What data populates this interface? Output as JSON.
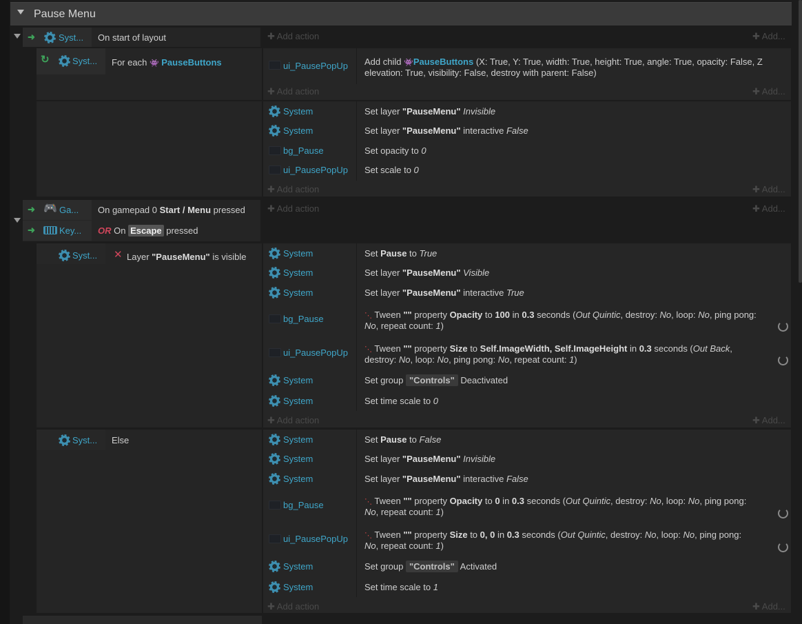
{
  "group": {
    "title": "Pause Menu"
  },
  "add_action": "Add action",
  "add_short": "Add...",
  "ev1": {
    "cond_obj": "Syst...",
    "cond_text": "On start of layout"
  },
  "ev1a": {
    "cond_obj": "Syst...",
    "cond_pre": "For each",
    "cond_target": "PauseButtons",
    "act_obj": "ui_PausePopUp",
    "act_pre": "Add child",
    "act_target": "PauseButtons",
    "act_line1": "(X: True, Y: True, width: True, height: True, angle: True, opacity: False, Z",
    "act_line2": "elevation: True, visibility: False, destroy with parent: False)"
  },
  "ev1b": {
    "actions": [
      {
        "obj": "System",
        "p1": "Set layer ",
        "b": "\"PauseMenu\"",
        "p2": " ",
        "it": "Invisible"
      },
      {
        "obj": "System",
        "p1": "Set layer ",
        "b": "\"PauseMenu\"",
        "p2": " interactive ",
        "it": "False"
      },
      {
        "obj": "bg_Pause",
        "p1": "Set opacity to ",
        "b": "",
        "p2": "",
        "it": "0"
      },
      {
        "obj": "ui_PausePopUp",
        "p1": "Set scale to ",
        "b": "",
        "p2": "",
        "it": "0"
      }
    ]
  },
  "ev2": {
    "c1_obj": "Ga...",
    "c1_pre": "On gamepad 0 ",
    "c1_bold": "Start / Menu",
    "c1_post": " pressed",
    "c2_obj": "Key...",
    "c2_or": "OR",
    "c2_pre": " On ",
    "c2_key": "Escape",
    "c2_post": " pressed"
  },
  "ev2a": {
    "cond_obj": "Syst...",
    "cond_pre": "Layer ",
    "cond_bold": "\"PauseMenu\"",
    "cond_post": " is visible",
    "a1": {
      "obj": "System",
      "p1": "Set ",
      "b": "Pause",
      "p2": " to ",
      "it": "True"
    },
    "a2": {
      "obj": "System",
      "p1": "Set layer ",
      "b": "\"PauseMenu\"",
      "p2": " ",
      "it": "Visible"
    },
    "a3": {
      "obj": "System",
      "p1": "Set layer ",
      "b": "\"PauseMenu\"",
      "p2": " interactive ",
      "it": "True"
    },
    "a4": {
      "obj": "bg_Pause",
      "l1a": "Tween ",
      "l1b": "\"\"",
      "l1c": " property ",
      "l1d": "Opacity",
      "l1e": " to ",
      "l1f": "100",
      "l1g": " in ",
      "l1h": "0.3",
      "l1i": " seconds (",
      "l1j": "Out Quintic",
      "l1k": ", destroy: ",
      "l1l": "No",
      "l1m": ", loop: ",
      "l1n": "No",
      "l1o": ", ping pong:",
      "l2a": "No",
      "l2b": ", repeat count: ",
      "l2c": "1",
      "l2d": ")"
    },
    "a5": {
      "obj": "ui_PausePopUp",
      "l1a": "Tween ",
      "l1b": "\"\"",
      "l1c": " property ",
      "l1d": "Size",
      "l1e": " to ",
      "l1f": "Self.ImageWidth, Self.ImageHeight",
      "l1g": " in ",
      "l1h": "0.3",
      "l1i": " seconds (",
      "l1j": "Out Back",
      "l1k": ",",
      "l2a": "destroy: ",
      "l2b": "No",
      "l2c": ", loop: ",
      "l2d": "No",
      "l2e": ", ping pong: ",
      "l2f": "No",
      "l2g": ", repeat count: ",
      "l2h": "1",
      "l2i": ")"
    },
    "a6": {
      "obj": "System",
      "p1": "Set group ",
      "chip": "\"Controls\"",
      "p2": " Deactivated"
    },
    "a7": {
      "obj": "System",
      "p1": "Set time scale to ",
      "it": "0"
    }
  },
  "ev2b": {
    "cond_obj": "Syst...",
    "cond_text": "Else",
    "a1": {
      "obj": "System",
      "p1": "Set ",
      "b": "Pause",
      "p2": " to ",
      "it": "False"
    },
    "a2": {
      "obj": "System",
      "p1": "Set layer ",
      "b": "\"PauseMenu\"",
      "p2": " ",
      "it": "Invisible"
    },
    "a3": {
      "obj": "System",
      "p1": "Set layer ",
      "b": "\"PauseMenu\"",
      "p2": " interactive ",
      "it": "False"
    },
    "a4": {
      "obj": "bg_Pause",
      "l1a": "Tween ",
      "l1b": "\"\"",
      "l1c": " property ",
      "l1d": "Opacity",
      "l1e": " to ",
      "l1f": "0",
      "l1g": " in ",
      "l1h": "0.3",
      "l1i": " seconds (",
      "l1j": "Out Quintic",
      "l1k": ", destroy: ",
      "l1l": "No",
      "l1m": ", loop: ",
      "l1n": "No",
      "l1o": ", ping pong:",
      "l2a": "No",
      "l2b": ", repeat count: ",
      "l2c": "1",
      "l2d": ")"
    },
    "a5": {
      "obj": "ui_PausePopUp",
      "l1a": "Tween ",
      "l1b": "\"\"",
      "l1c": " property ",
      "l1d": "Size",
      "l1e": " to ",
      "l1f": "0, 0",
      "l1g": " in ",
      "l1h": "0.3",
      "l1i": " seconds (",
      "l1j": "Out Quintic",
      "l1k": ", destroy: ",
      "l1l": "No",
      "l1m": ", loop: ",
      "l1n": "No",
      "l1o": ", ping pong:",
      "l2a": "No",
      "l2b": ", repeat count: ",
      "l2c": "1",
      "l2d": ")"
    },
    "a6": {
      "obj": "System",
      "p1": "Set group ",
      "chip": "\"Controls\"",
      "p2": " Activated"
    },
    "a7": {
      "obj": "System",
      "p1": "Set time scale to ",
      "it": "1"
    }
  },
  "colors": {
    "object": "#3fa6c9",
    "or": "#d0465b",
    "trigger_arrow": "#3ea35a"
  },
  "icons": [
    "gear-icon",
    "gamepad-icon",
    "keyboard-icon",
    "sprite-icon",
    "loop-icon",
    "invert-x-icon",
    "tween-icon",
    "replay-icon",
    "expand-triangle-icon"
  ]
}
